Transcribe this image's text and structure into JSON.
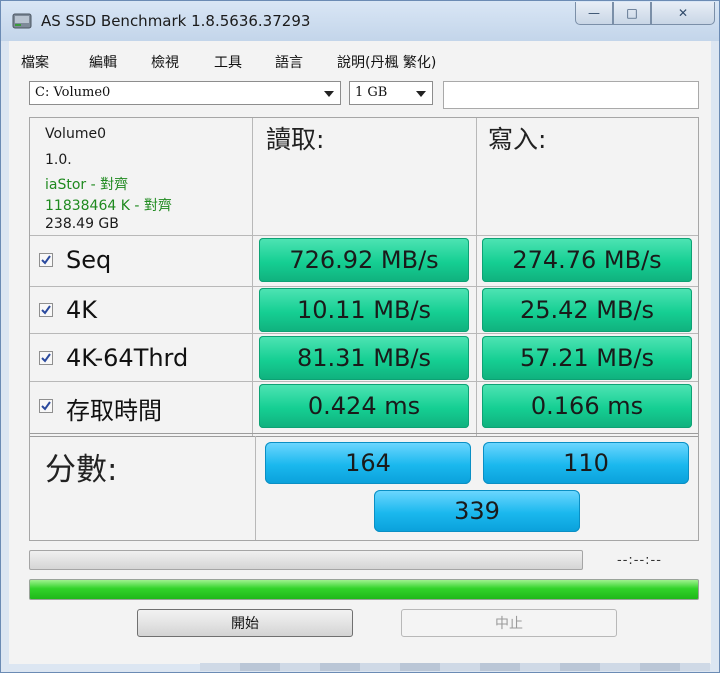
{
  "window": {
    "title": "AS SSD Benchmark 1.8.5636.37293"
  },
  "caption": {
    "minimize": "—",
    "maximize": "□",
    "close": "✕"
  },
  "menu": [
    "檔案",
    "編輯",
    "檢視",
    "工具",
    "語言",
    "說明(丹楓 繁化)"
  ],
  "drive_select": {
    "value": "C: Volume0"
  },
  "size_select": {
    "value": "1 GB"
  },
  "drive_info": {
    "name": "Volume0",
    "version": "1.0.",
    "driver": "iaStor - 對齊",
    "alignment": "11838464 K - 對齊",
    "capacity": "238.49 GB"
  },
  "headers": {
    "read": "讀取:",
    "write": "寫入:"
  },
  "tests": [
    {
      "label": "Seq",
      "checked": true,
      "read": "726.92 MB/s",
      "write": "274.76 MB/s"
    },
    {
      "label": "4K",
      "checked": true,
      "read": "10.11 MB/s",
      "write": "25.42 MB/s"
    },
    {
      "label": "4K-64Thrd",
      "checked": true,
      "read": "81.31 MB/s",
      "write": "57.21 MB/s"
    },
    {
      "label": "存取時間",
      "checked": true,
      "read": "0.424 ms",
      "write": "0.166 ms"
    }
  ],
  "score": {
    "label": "分數:",
    "read": "164",
    "write": "110",
    "total": "339"
  },
  "progress": {
    "elapsed": "--:--:--",
    "test_progress": 0,
    "total_progress": 1.0
  },
  "buttons": {
    "start": "開始",
    "stop": "中止"
  },
  "colors": {
    "result_green": "#15cf93",
    "score_blue": "#1ab8ee",
    "progress_green": "#32d32a"
  }
}
